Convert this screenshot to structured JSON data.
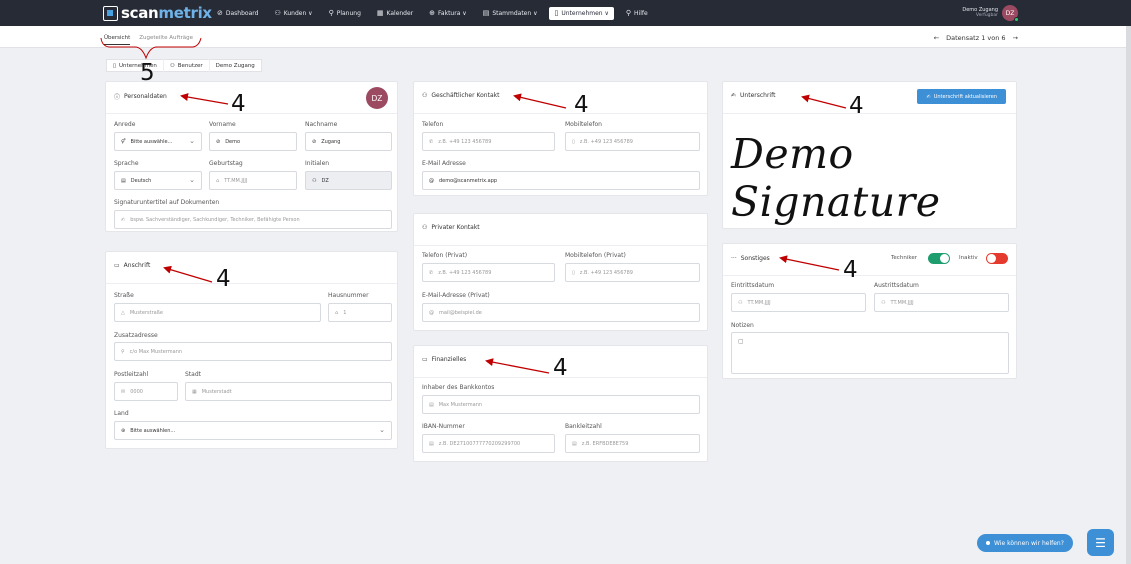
{
  "topnav": {
    "logo_scan": "scan",
    "logo_metrix": "metrix",
    "items": [
      {
        "label": "Dashboard",
        "icon": "⊘"
      },
      {
        "label": "Kunden ∨",
        "icon": "⚇"
      },
      {
        "label": "Planung",
        "icon": "⚲"
      },
      {
        "label": "Kalender",
        "icon": "▦"
      },
      {
        "label": "Faktura ∨",
        "icon": "⊕"
      },
      {
        "label": "Stammdaten ∨",
        "icon": "▤"
      },
      {
        "label": "Unternehmen ∨",
        "icon": "▯"
      },
      {
        "label": "Hilfe",
        "icon": "⚲"
      }
    ],
    "user_name": "Demo Zugang",
    "user_status": "Verfügbar",
    "user_initials": "DZ"
  },
  "subheader": {
    "tab_overview": "Übersicht",
    "tab_orders": "Zugeteilte Aufträge",
    "pager_text": "Datensatz 1 von 6",
    "prev": "←",
    "next": "→"
  },
  "subtabs": {
    "company": "Unternehmen",
    "users": "Benutzer",
    "demo": "Demo Zugang"
  },
  "personal": {
    "title": "Personaldaten",
    "initials": "DZ",
    "anrede_label": "Anrede",
    "anrede_value": "Bitte auswähle...",
    "vorname_label": "Vorname",
    "vorname_value": "Demo",
    "nachname_label": "Nachname",
    "nachname_value": "Zugang",
    "sprache_label": "Sprache",
    "sprache_value": "Deutsch",
    "geburtstag_label": "Geburtstag",
    "geburtstag_placeholder": "TT.MM.JJJJ",
    "initialen_label": "Initialen",
    "initialen_value": "DZ",
    "signatur_label": "Signaturuntertitel auf Dokumenten",
    "signatur_placeholder": "bspw. Sachverständiger, Sachkundiger, Techniker, Befähigte Person"
  },
  "address": {
    "title": "Anschrift",
    "strasse_label": "Straße",
    "strasse_placeholder": "Musterstraße",
    "hausnummer_label": "Hausnummer",
    "hausnummer_placeholder": "1",
    "zusatz_label": "Zusatzadresse",
    "zusatz_placeholder": "c/o Max Mustermann",
    "plz_label": "Postleitzahl",
    "plz_placeholder": "0000",
    "stadt_label": "Stadt",
    "stadt_placeholder": "Musterstadt",
    "land_label": "Land",
    "land_value": "Bitte auswählen..."
  },
  "business": {
    "title": "Geschäftlicher Kontakt",
    "telefon_label": "Telefon",
    "telefon_placeholder": "z.B. +49 123 456789",
    "mobil_label": "Mobiltelefon",
    "mobil_placeholder": "z.B. +49 123 456789",
    "email_label": "E-Mail Adresse",
    "email_value": "demo@scanmetrix.app"
  },
  "private": {
    "title": "Privater Kontakt",
    "telefon_label": "Telefon (Privat)",
    "telefon_placeholder": "z.B. +49 123 456789",
    "mobil_label": "Mobiltelefon (Privat)",
    "mobil_placeholder": "z.B. +49 123 456789",
    "email_label": "E-Mail-Adresse (Privat)",
    "email_placeholder": "mail@beispiel.de"
  },
  "finance": {
    "title": "Finanzielles",
    "inhaber_label": "Inhaber des Bankkontos",
    "inhaber_placeholder": "Max Mustermann",
    "iban_label": "IBAN-Nummer",
    "iban_placeholder": "z.B. DE27100777770209299700",
    "blz_label": "Bankleitzahl",
    "blz_placeholder": "z.B. ERFBDE8E759"
  },
  "signature": {
    "title": "Unterschrift",
    "button": "Unterschrift aktualisieren",
    "text": "Demo Signature"
  },
  "misc": {
    "title": "Sonstiges",
    "techniker_label": "Techniker",
    "techniker_on": true,
    "inaktiv_label": "Inaktiv",
    "inaktiv_on": false,
    "eintritt_label": "Eintrittsdatum",
    "eintritt_placeholder": "TT.MM.JJJJ",
    "austritt_label": "Austrittsdatum",
    "austritt_placeholder": "TT.MM.JJJJ",
    "notizen_label": "Notizen"
  },
  "annotations": {
    "n4": "4",
    "n5": "5",
    "color": "#c00000"
  },
  "help": {
    "label": "Wie können wir helfen?"
  }
}
